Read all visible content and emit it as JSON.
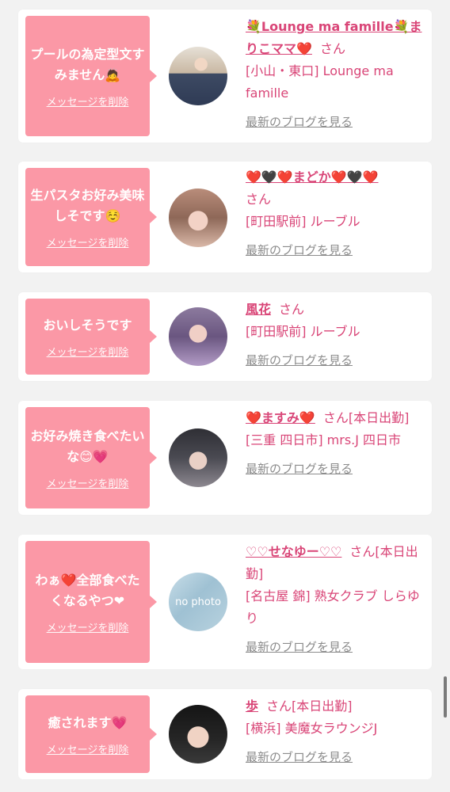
{
  "delete_label": "メッセージを削除",
  "blog_label": "最新のブログを見る",
  "san_label": "さん",
  "san_today_label": "さん[本日出勤]",
  "items": [
    {
      "message": "プールの為定型文すみません🙇",
      "name": "💐Lounge ma famille💐まりこママ❤️",
      "shop": "[小山・東口] Lounge ma famille",
      "avatar": "kimono-photo-avatar"
    },
    {
      "message": "生パスタお好み美味しそです☺️",
      "name": "❤️🖤❤️まどか❤️🖤❤️",
      "shop": "[町田駅前] ルーブル",
      "avatar": "girl-photo-avatar"
    },
    {
      "message": "おいしそうです",
      "name": "風花",
      "shop": "[町田駅前] ルーブル",
      "avatar": "purple-photo-avatar"
    },
    {
      "message": "お好み焼き食べたいな😊💗",
      "name": "❤️ますみ❤️",
      "shop": "[三重 四日市] mrs.J 四日市",
      "avatar": "cat-filter-avatar"
    },
    {
      "message": "わぁ❤️全部食べたくなるやつ❤",
      "name": "♡♡せなゆー♡♡",
      "shop": "[名古屋 錦] 熟女クラブ しらゆり",
      "avatar": "no-photo-avatar",
      "avatar_text": "no photo"
    },
    {
      "message": "癒されます💗",
      "name": "歩",
      "shop": "[横浜] 美魔女ラウンジJ",
      "avatar": "black-hair-avatar"
    }
  ]
}
